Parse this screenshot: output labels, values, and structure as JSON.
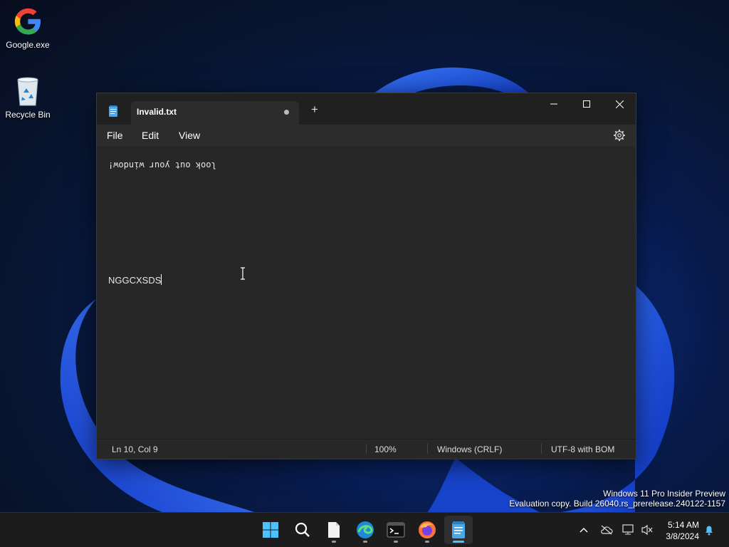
{
  "desktop": {
    "icons": [
      {
        "label": "Google.exe",
        "icon": "google-icon"
      },
      {
        "label": "Recycle Bin",
        "icon": "recycle-bin-icon"
      }
    ],
    "watermark": {
      "line1": "Windows 11 Pro Insider Preview",
      "line2": "Evaluation copy. Build 26040.rs_prerelease.240122-1157"
    }
  },
  "notepad": {
    "tab_title": "Invalid.txt",
    "new_tab_label": "+",
    "menu": {
      "file": "File",
      "edit": "Edit",
      "view": "View"
    },
    "editor": {
      "line1": "look out your window!",
      "line2": "NGGCXSDS"
    },
    "status": {
      "position": "Ln 10, Col 9",
      "zoom": "100%",
      "line_ending": "Windows (CRLF)",
      "encoding": "UTF-8 with BOM"
    }
  },
  "taskbar": {
    "apps": [
      "start-icon",
      "search-icon",
      "file-icon",
      "edge-icon",
      "terminal-icon",
      "firefox-icon",
      "notepad-icon"
    ],
    "clock": {
      "time": "5:14 AM",
      "date": "3/8/2024"
    }
  },
  "colors": {
    "accent": "#4cc2ff",
    "window_bg": "#272727",
    "titlebar_bg": "#202020",
    "taskbar_bg": "#1c1c1c"
  }
}
